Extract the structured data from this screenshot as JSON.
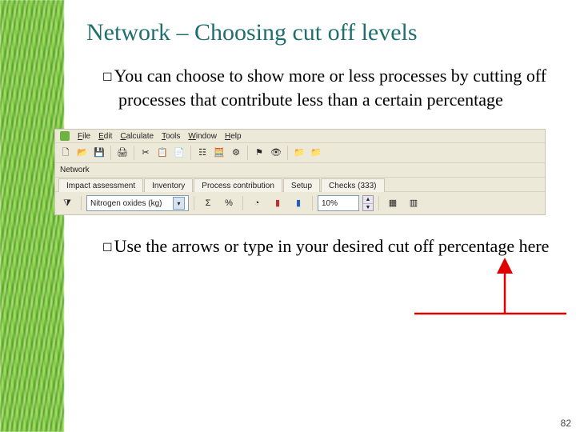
{
  "title": "Network – Choosing cut off levels",
  "bullet1": "You can choose to show more or less processes by cutting off processes that contribute less than a certain percentage",
  "bullet2": "Use the arrows or type in your desired cut off percentage here",
  "page_number": "82",
  "menu": {
    "file": "File",
    "edit": "Edit",
    "calculate": "Calculate",
    "tools": "Tools",
    "window": "Window",
    "help": "Help"
  },
  "window_title": "Network",
  "tabs": {
    "t1": "Impact assessment",
    "t2": "Inventory",
    "t3": "Process contribution",
    "t4": "Setup",
    "t5": "Checks (333)"
  },
  "param": {
    "series_label": "Nitrogen oxides (kg)",
    "sigma": "Σ",
    "percent": "%",
    "cutoff_value": "10%"
  },
  "icons": {
    "new": "🗋",
    "open": "📂",
    "save": "💾",
    "print": "🖨",
    "cut": "✂",
    "copy": "📋",
    "paste": "📄",
    "tree": "☷",
    "calc": "🧮",
    "folder": "📁",
    "flag": "⚑",
    "pie": "◔",
    "bars": "▮",
    "eye": "👁",
    "funnel": "⧩",
    "up": "▲",
    "down": "▼",
    "dropdown": "▾",
    "gear": "⚙",
    "square": "▦",
    "square2": "▥"
  }
}
